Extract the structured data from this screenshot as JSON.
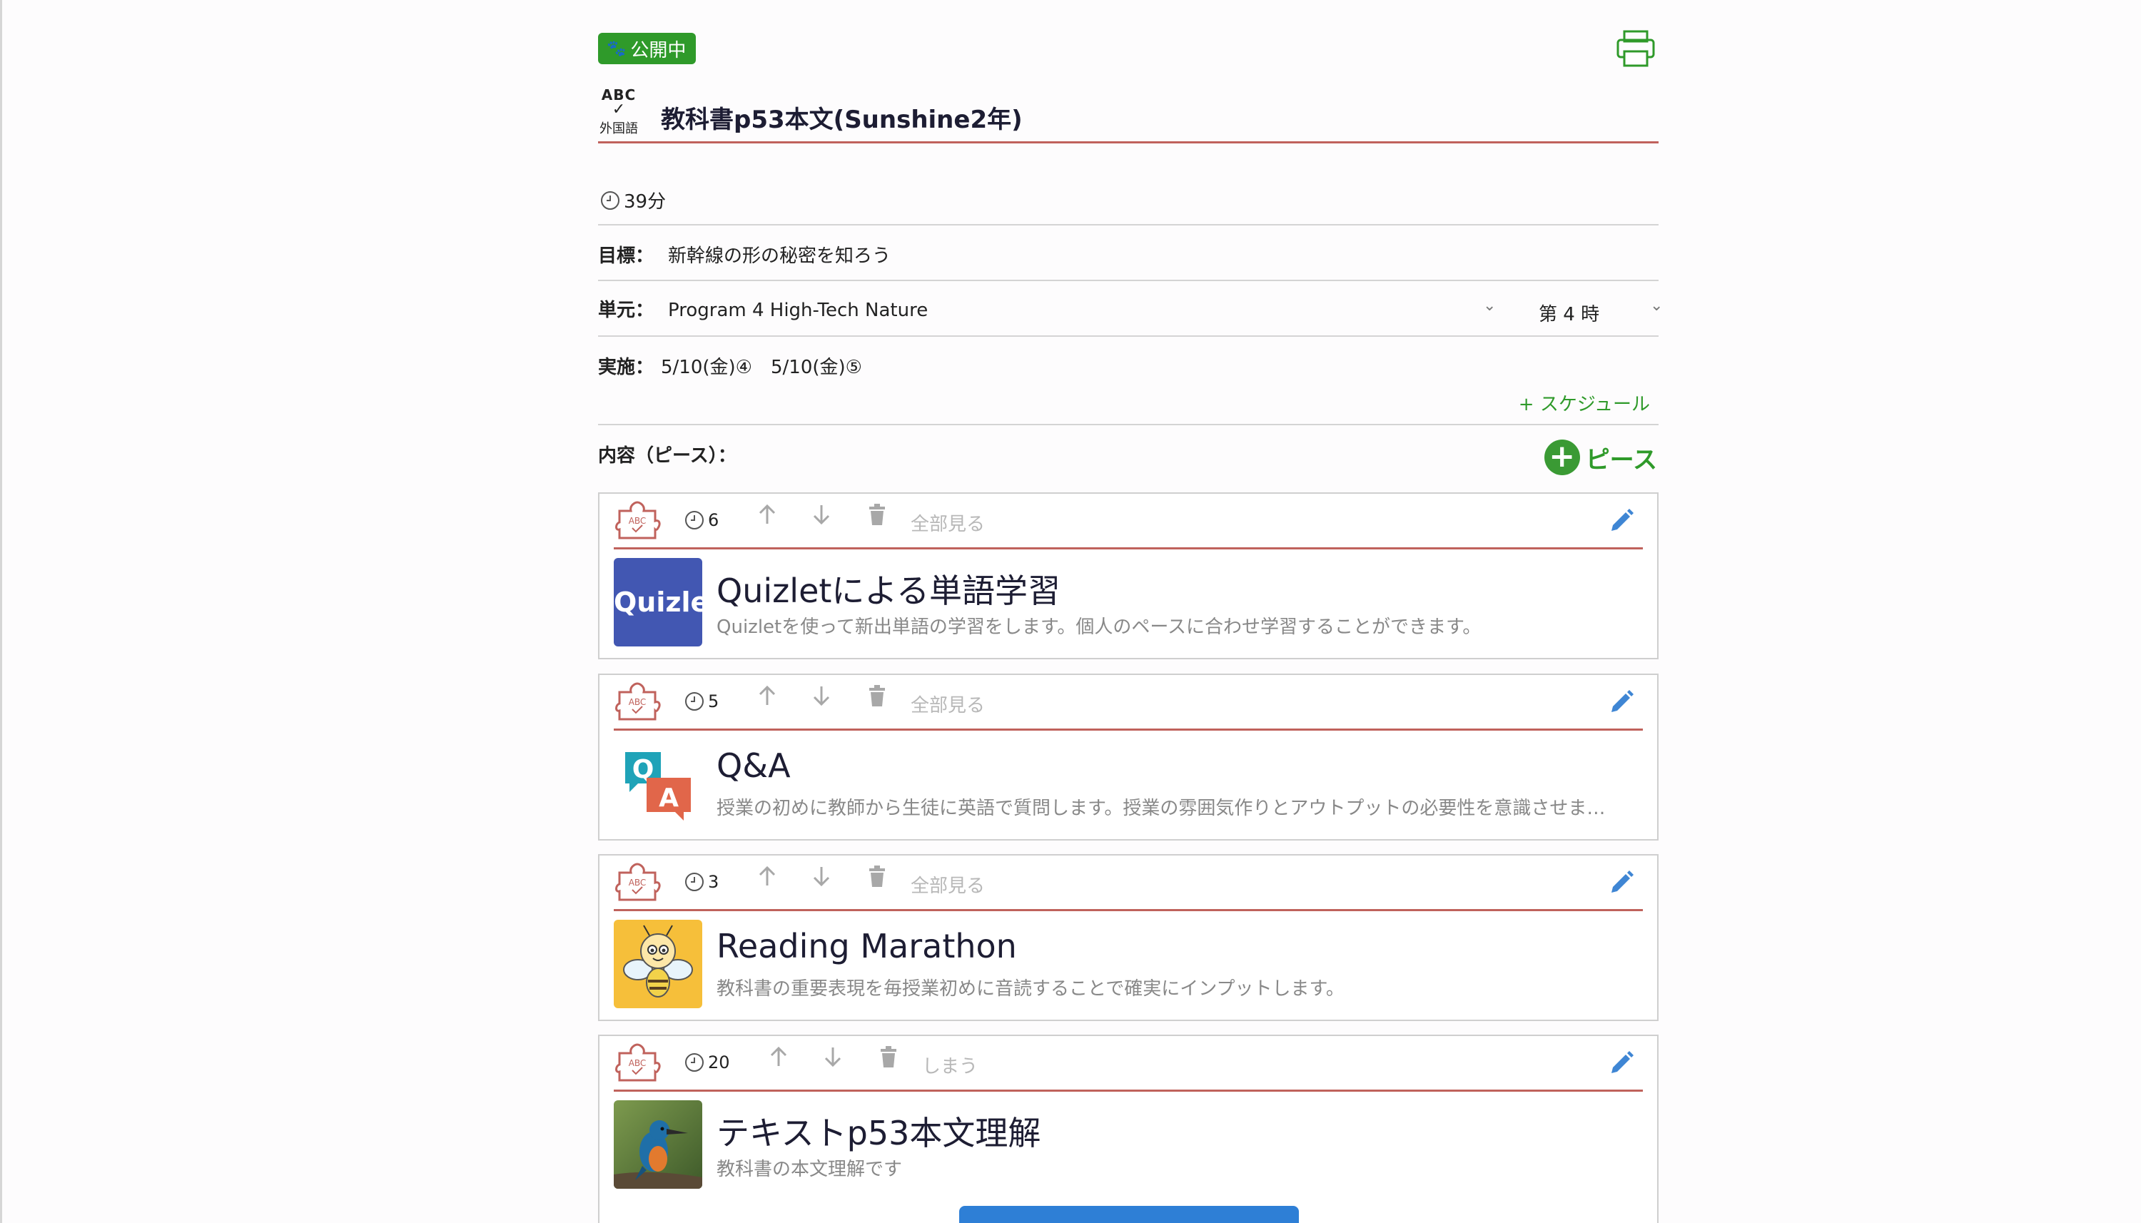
{
  "header": {
    "status_badge": "公開中",
    "subject_abc": "ABC",
    "subject_label": "外国語",
    "lesson_title": "教科書p53本文(Sunshine2年)"
  },
  "info": {
    "duration": "39分",
    "goal_label": "目標：",
    "goal_value": "新幹線の形の秘密を知ろう",
    "unit_label": "単元：",
    "unit_value": "Program 4 High-Tech Nature",
    "period_value": "第 4 時",
    "date_label": "実施：",
    "dates": [
      "5/10(金)④",
      "5/10(金)⑤"
    ],
    "schedule_link": "+ スケジュール"
  },
  "pieces_section": {
    "label": "内容（ピース）：",
    "add_label": "ピース"
  },
  "pieces": [
    {
      "minutes": "6",
      "action_link": "全部見る",
      "title": "Quizletによる単語学習",
      "description": "Quizletを使って新出単語の学習をします。個人のペースに合わせ学習することができます。",
      "thumb_text": "Quizlet"
    },
    {
      "minutes": "5",
      "action_link": "全部見る",
      "title": "Q&A",
      "description": "授業の初めに教師から生徒に英語で質問します。授業の雰囲気作りとアウトプットの必要性を意識させま…",
      "thumb_q": "Q",
      "thumb_a": "A"
    },
    {
      "minutes": "3",
      "action_link": "全部見る",
      "title": "Reading Marathon",
      "description": "教科書の重要表現を毎授業初めに音読することで確実にインプットします。"
    },
    {
      "minutes": "20",
      "action_link": "しまう",
      "title": "テキストp53本文理解",
      "description": "教科書の本文理解です"
    }
  ],
  "colors": {
    "green": "#2f9a2a",
    "accent_line": "#c0625c",
    "edit_blue": "#3f86d4",
    "primary_button": "#2e7fd6"
  }
}
